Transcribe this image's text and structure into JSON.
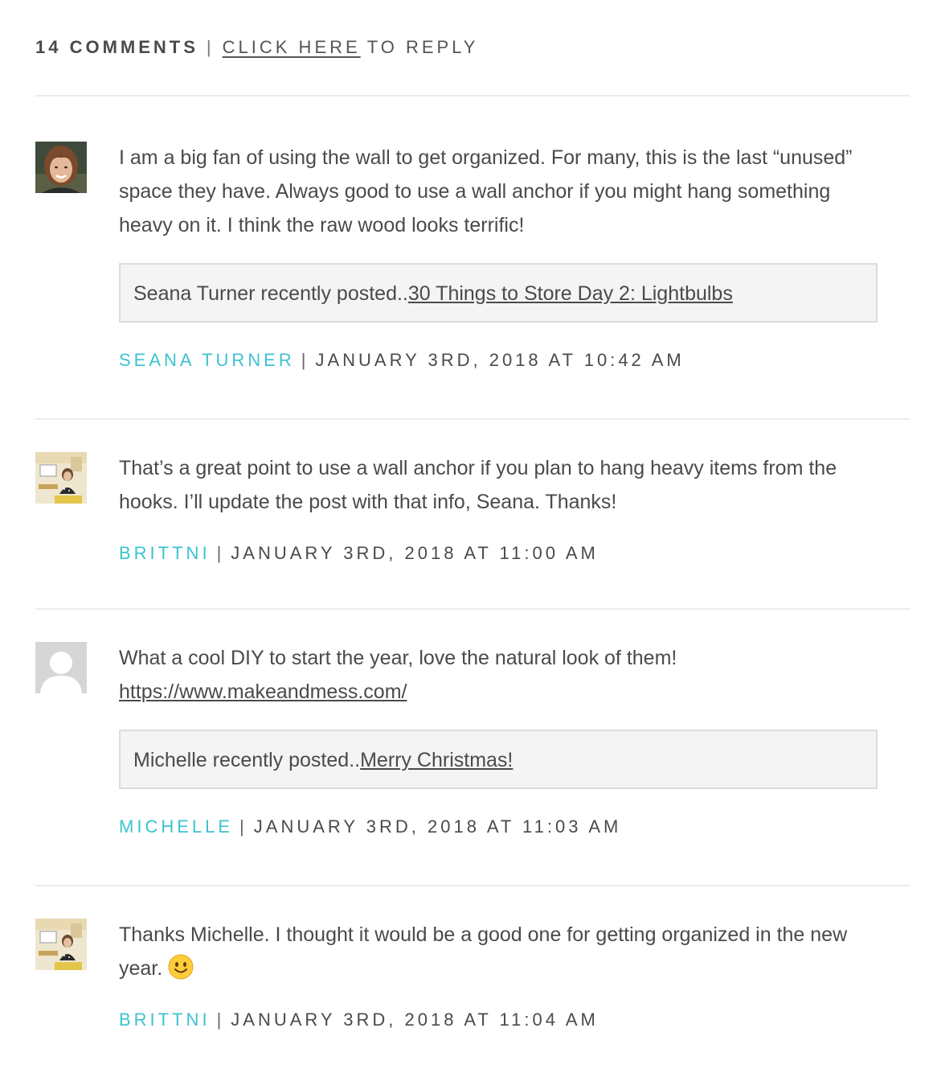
{
  "header": {
    "count": "14 COMMENTS",
    "separator": "|",
    "reply_link": "CLICK HERE",
    "reply_tail": "TO REPLY"
  },
  "comments": [
    {
      "avatar": "photo-woman-icon",
      "text": "I am a big fan of using the wall to get organized. For many, this is the last “unused” space they have. Always good to use a wall anchor if you might hang something heavy on it. I think the raw wood looks terrific!",
      "posted_prefix": "Seana Turner recently posted..",
      "posted_link": "30 Things to Store Day 2: Lightbulbs",
      "author": "SEANA TURNER",
      "separator": "|",
      "date": "JANUARY 3RD, 2018 AT 10:42 AM"
    },
    {
      "avatar": "photo-brittni-icon",
      "text": "That’s a great point to use a wall anchor if you plan to hang heavy items from the hooks. I’ll update the post with that info, Seana. Thanks!",
      "author": "BRITTNI",
      "separator": "|",
      "date": "JANUARY 3RD, 2018 AT 11:00 AM"
    },
    {
      "avatar": "default-user-icon",
      "text": "What a cool DIY to start the year, love the natural look of them!",
      "url": "https://www.makeandmess.com/",
      "posted_prefix": "Michelle recently posted..",
      "posted_link": "Merry Christmas!",
      "author": "MICHELLE",
      "separator": "|",
      "date": "JANUARY 3RD, 2018 AT 11:03 AM"
    },
    {
      "avatar": "photo-brittni-icon",
      "text": "Thanks Michelle. I thought it would be a good one for getting organized in the new year.",
      "emoji": "smile-emoji-icon",
      "author": "BRITTNI",
      "separator": "|",
      "date": "JANUARY 3RD, 2018 AT 11:04 AM"
    }
  ],
  "colors": {
    "author": "#3cc3cf",
    "text": "#4a4a4a",
    "divider": "#ececec",
    "posted_bg": "#f4f4f4",
    "posted_border": "#dcdcdc"
  }
}
